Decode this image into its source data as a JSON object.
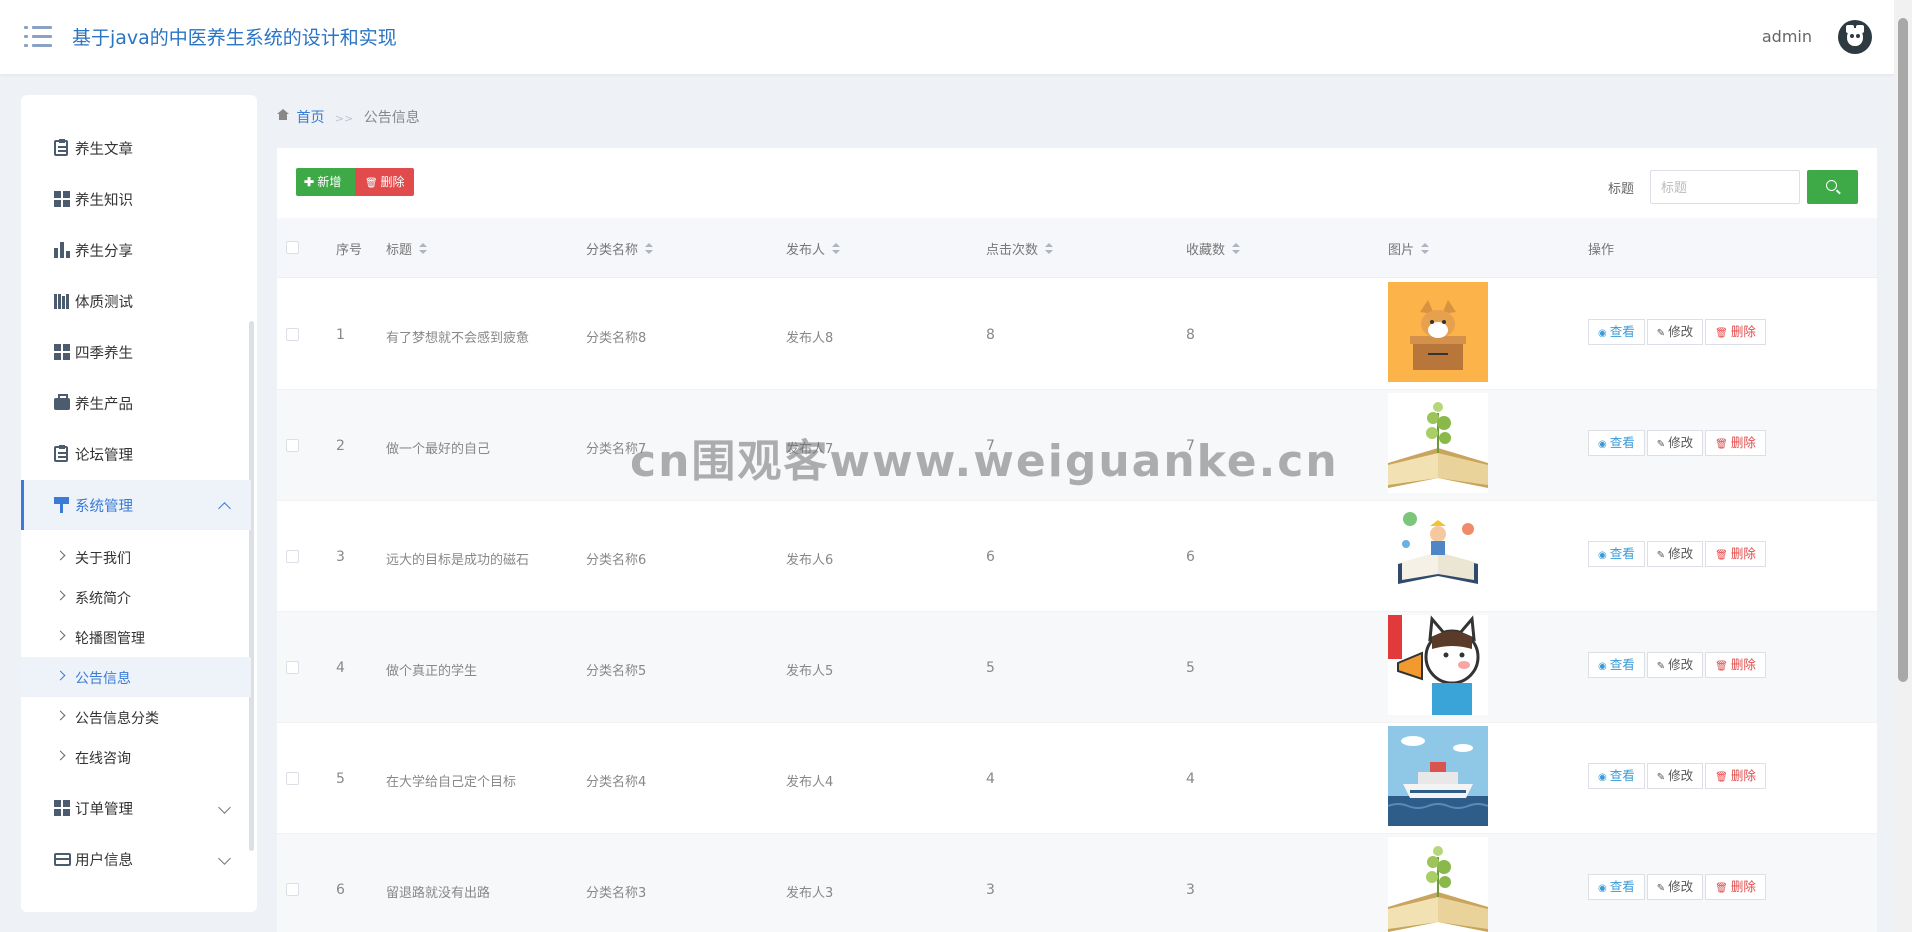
{
  "header": {
    "title": "基于java的中医养生系统的设计和实现",
    "user": "admin"
  },
  "sidebar": {
    "items": [
      {
        "label": "养生文章",
        "icon": "clipboard-icon"
      },
      {
        "label": "养生知识",
        "icon": "grid-icon"
      },
      {
        "label": "养生分享",
        "icon": "bar-chart-icon"
      },
      {
        "label": "体质测试",
        "icon": "books-icon"
      },
      {
        "label": "四季养生",
        "icon": "grid-icon"
      },
      {
        "label": "养生产品",
        "icon": "briefcase-icon"
      },
      {
        "label": "论坛管理",
        "icon": "clipboard-icon"
      },
      {
        "label": "系统管理",
        "icon": "paint-roller-icon"
      },
      {
        "label": "订单管理",
        "icon": "grid-icon"
      },
      {
        "label": "用户信息",
        "icon": "card-icon"
      }
    ],
    "sub_items": [
      "关于我们",
      "系统简介",
      "轮播图管理",
      "公告信息",
      "公告信息分类",
      "在线咨询"
    ]
  },
  "breadcrumb": {
    "home": "首页",
    "sep": ">>",
    "current": "公告信息"
  },
  "toolbar": {
    "add_label": "新增",
    "delete_label": "删除",
    "search_label": "标题",
    "search_placeholder": "标题"
  },
  "table": {
    "columns": [
      "序号",
      "标题",
      "分类名称",
      "发布人",
      "点击次数",
      "收藏数",
      "图片",
      "操作"
    ],
    "rows": [
      {
        "index": "1",
        "title": "有了梦想就不会感到疲惫",
        "category": "分类名称8",
        "publisher": "发布人8",
        "clicks": "8",
        "favorites": "8"
      },
      {
        "index": "2",
        "title": "做一个最好的自己",
        "category": "分类名称7",
        "publisher": "发布人7",
        "clicks": "7",
        "favorites": "7"
      },
      {
        "index": "3",
        "title": "远大的目标是成功的磁石",
        "category": "分类名称6",
        "publisher": "发布人6",
        "clicks": "6",
        "favorites": "6"
      },
      {
        "index": "4",
        "title": "做个真正的学生",
        "category": "分类名称5",
        "publisher": "发布人5",
        "clicks": "5",
        "favorites": "5"
      },
      {
        "index": "5",
        "title": "在大学给自己定个目标",
        "category": "分类名称4",
        "publisher": "发布人4",
        "clicks": "4",
        "favorites": "4"
      },
      {
        "index": "6",
        "title": "留退路就没有出路",
        "category": "分类名称3",
        "publisher": "发布人3",
        "clicks": "3",
        "favorites": "3"
      }
    ],
    "actions": {
      "view": "查看",
      "edit": "修改",
      "delete": "删除"
    }
  },
  "watermark": "cn围观客www.weiguanke.cn",
  "colors": {
    "accent": "#3a7bd5",
    "success": "#3eaa47",
    "danger": "#e24b4b"
  }
}
